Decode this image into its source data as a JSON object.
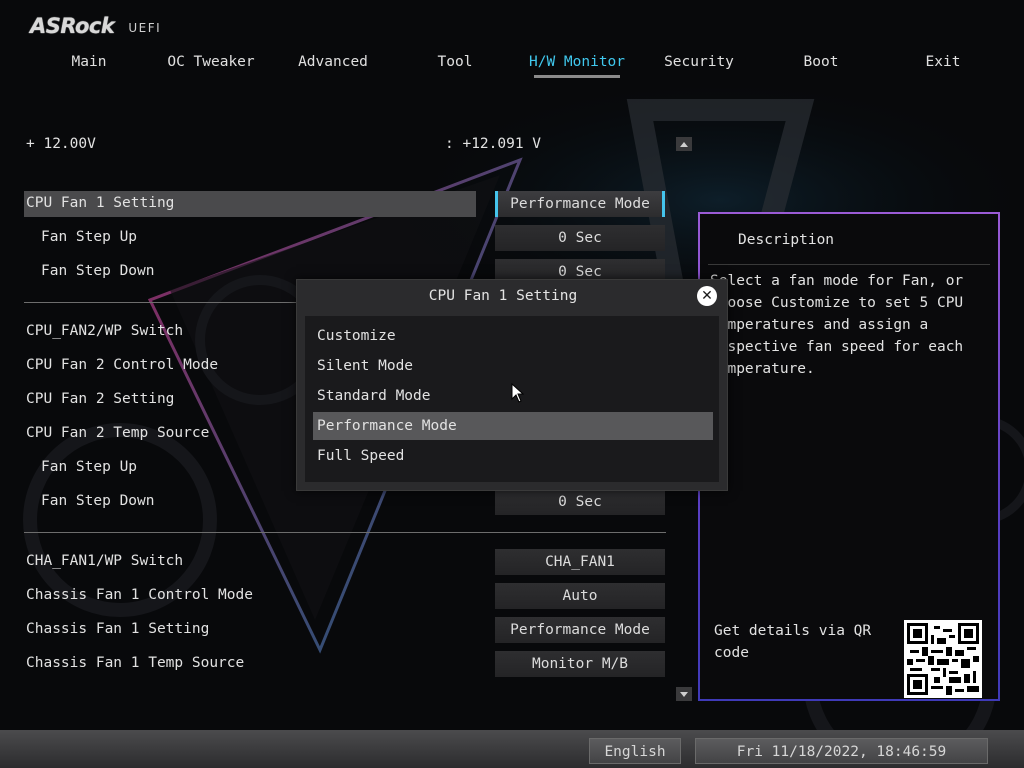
{
  "header": {
    "brand": "ASRock",
    "subtitle": "UEFI"
  },
  "nav": {
    "tabs": [
      {
        "label": "Main"
      },
      {
        "label": "OC Tweaker"
      },
      {
        "label": "Advanced"
      },
      {
        "label": "Tool"
      },
      {
        "label": "H/W Monitor",
        "active": true
      },
      {
        "label": "Security"
      },
      {
        "label": "Boot"
      },
      {
        "label": "Exit"
      }
    ]
  },
  "voltage": {
    "label": "+ 12.00V",
    "value": ": +12.091 V"
  },
  "settings": [
    {
      "label": "CPU Fan 1 Setting",
      "value": "Performance Mode"
    },
    {
      "label": "Fan Step Up",
      "value": "0 Sec"
    },
    {
      "label": "Fan Step Down",
      "value": "0 Sec"
    },
    {
      "label": "CPU_FAN2/WP Switch",
      "value": ""
    },
    {
      "label": "CPU Fan 2 Control Mode",
      "value": ""
    },
    {
      "label": "CPU Fan 2 Setting",
      "value": ""
    },
    {
      "label": "CPU Fan 2 Temp Source",
      "value": ""
    },
    {
      "label": "Fan Step Up",
      "value": ""
    },
    {
      "label": "Fan Step Down",
      "value": "0 Sec"
    },
    {
      "label": "CHA_FAN1/WP Switch",
      "value": "CHA_FAN1"
    },
    {
      "label": "Chassis Fan 1 Control Mode",
      "value": "Auto"
    },
    {
      "label": "Chassis Fan 1 Setting",
      "value": "Performance Mode"
    },
    {
      "label": "Chassis Fan 1 Temp Source",
      "value": "Monitor M/B"
    }
  ],
  "description": {
    "title": "Description",
    "text": "Select a fan mode for Fan, or\nchoose Customize to set 5 CPU\ntemperatures and assign a\nrespective fan speed for each\ntemperature.",
    "qr_text": "Get details via QR code"
  },
  "modal": {
    "title": "CPU Fan 1 Setting",
    "options": [
      "Customize",
      "Silent Mode",
      "Standard Mode",
      "Performance Mode",
      "Full Speed"
    ],
    "selected_index": 3
  },
  "footer": {
    "language": "English",
    "datetime": "Fri 11/18/2022, 18:46:59"
  },
  "colors": {
    "accent": "#40c8ee",
    "border_purple": "#9b5bd6"
  }
}
